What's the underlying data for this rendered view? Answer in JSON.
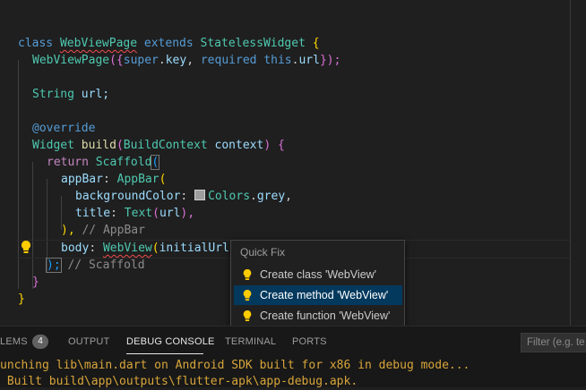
{
  "editor": {
    "lines": {
      "l1": {
        "kw_class": "class",
        "classname": "WebViewPage",
        "kw_extends": "extends",
        "super": "StatelessWidget",
        "open": "{"
      },
      "l2": {
        "ctor": "WebViewPage",
        "open": "({",
        "kw_super": "super",
        "dot": ".",
        "key": "key",
        ", ": ", ",
        "required": "required",
        "this": "this",
        "url": "url",
        "close": "});"
      },
      "l4": {
        "type": "String",
        "rest": " url;"
      },
      "l6": {
        "ann": "@override"
      },
      "l7": {
        "type": "Widget",
        "fn": "build",
        "open": "(",
        "ctx_type": "BuildContext",
        "ctx": " context",
        "close": ")",
        "brace": " {"
      },
      "l8": {
        "ret": "return",
        "sc": "Scaffold",
        "open": "("
      },
      "l9": {
        "prop": "appBar",
        "colon": ": ",
        "type": "AppBar",
        "open": "("
      },
      "l10": {
        "prop": "backgroundColor",
        "colon": ": ",
        "colors": "Colors",
        "dot": ".",
        "grey": "grey",
        "comma": ","
      },
      "l11": {
        "prop": "title",
        "colon": ": ",
        "type": "Text",
        "open": "(",
        "arg": "url",
        "close": "),"
      },
      "l12": {
        "close": "),",
        "cmt": " // AppBar"
      },
      "l13": {
        "prop": "body",
        "colon": ": ",
        "type": "WebView",
        "open": "(",
        "arg": "initialUrl:"
      },
      "l14": {
        "close": ");",
        "cmt": " // Scaffold"
      },
      "l15": {
        "close": "}"
      },
      "l16": {
        "close": "}"
      }
    }
  },
  "quick_fix": {
    "title": "Quick Fix",
    "items": [
      {
        "label": "Create class 'WebView'"
      },
      {
        "label": "Create method 'WebView'"
      },
      {
        "label": "Create function 'WebView'"
      }
    ],
    "selected_index": 1
  },
  "panel": {
    "tabs": [
      "LEMS",
      "OUTPUT",
      "DEBUG CONSOLE",
      "TERMINAL",
      "PORTS"
    ],
    "problems_count": "4",
    "active_tab": "DEBUG CONSOLE",
    "filter_placeholder": "Filter (e.g. te",
    "console": [
      "unching lib\\main.dart on Android SDK built for x86 in debug mode...",
      " Built build\\app\\outputs\\flutter-apk\\app-debug.apk."
    ]
  },
  "icons": [
    "lightbulb-icon"
  ],
  "colors": {
    "lightbulb": "#ffcc00",
    "selection": "#04395e",
    "console_text": "#d8a53a"
  }
}
